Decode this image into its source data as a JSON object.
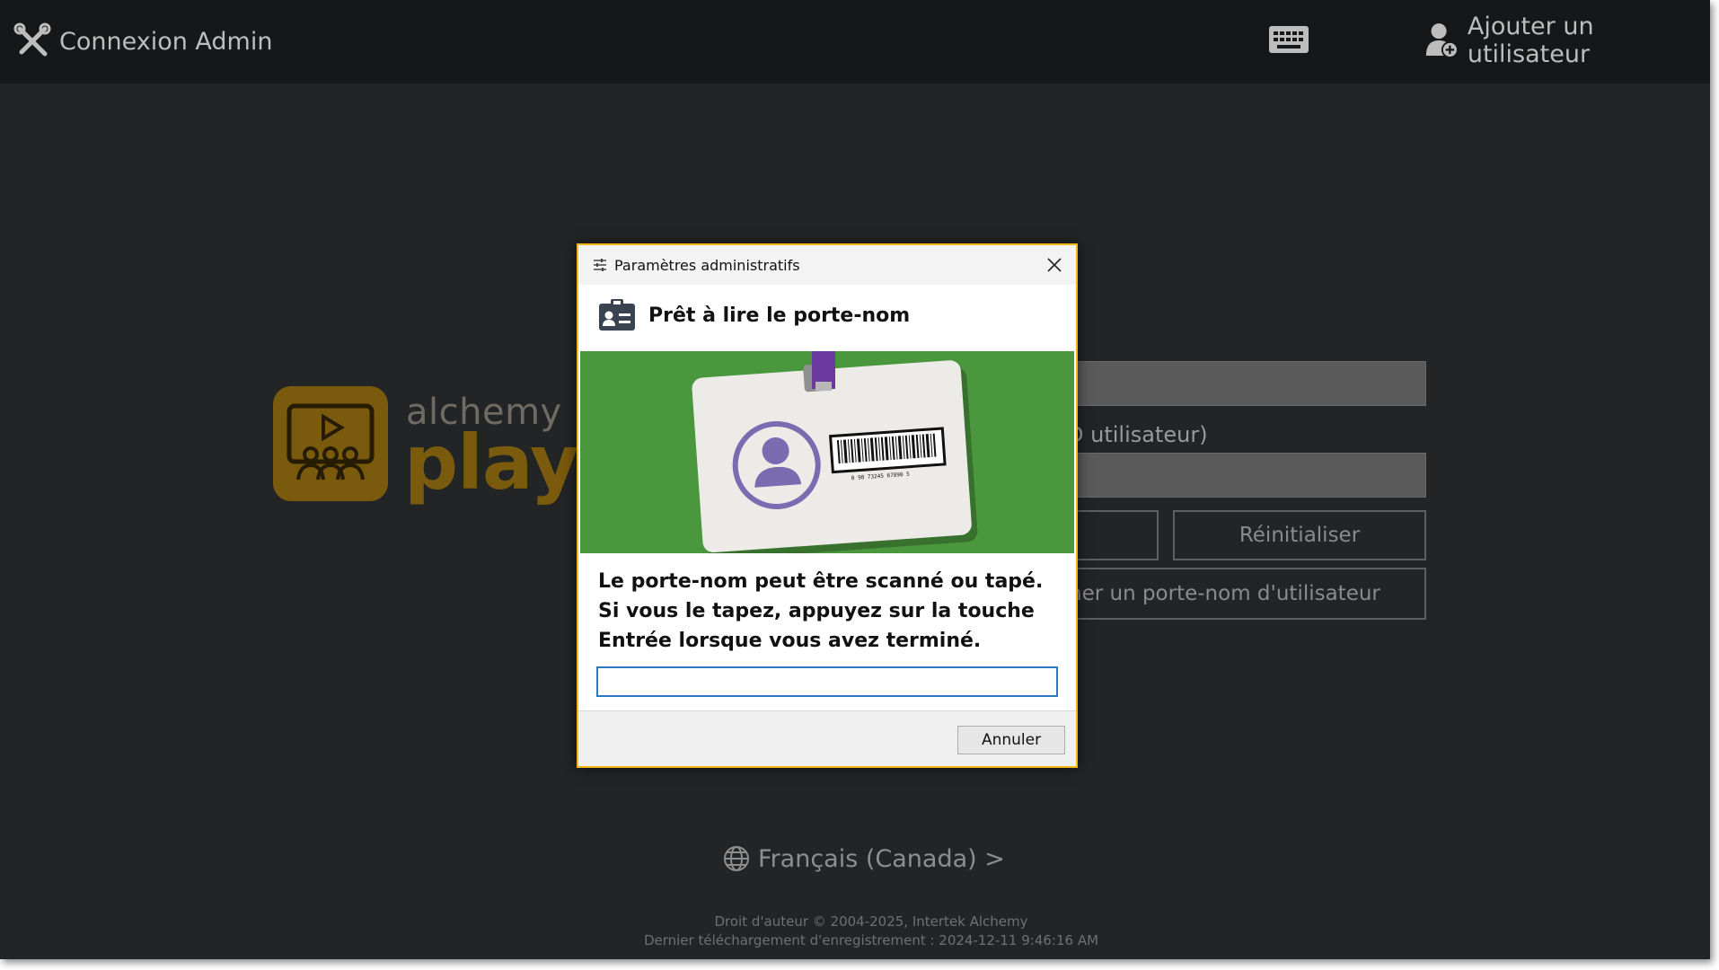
{
  "topbar": {
    "admin_login_label": "Connexion Admin",
    "keyboard_button": "keyboard-icon",
    "add_user_label": "Ajouter un utilisateur"
  },
  "background": {
    "logo_line1": "alchemy",
    "logo_line2": "player",
    "user_id_label_partial": "D utilisateur)",
    "login_button_partial": "",
    "reset_button_label": "Réinitialiser",
    "badge_button_partial": "ner un porte-nom d'utilisateur",
    "language_label": "Français (Canada) >",
    "copyright": "Droit d'auteur © 2004-2025, Intertek Alchemy",
    "last_download": "Dernier téléchargement d'enregistrement : 2024-12-11 9:46:16 AM"
  },
  "dialog": {
    "title": "Paramètres administratifs",
    "heading": "Prêt à lire le porte-nom",
    "instructions": "Le porte-nom peut être scanné ou tapé. Si vous le tapez, appuyez sur la touche Entrée lorsque vous avez terminé.",
    "input_value": "",
    "cancel_label": "Annuler",
    "badge_barcode_text": "0 98 73245 67890 5"
  },
  "colors": {
    "dialog_border": "#f2b716",
    "brand": "#7a5a0c",
    "badge_green": "#4d9a3f",
    "avatar_purple": "#7b6bb0"
  }
}
